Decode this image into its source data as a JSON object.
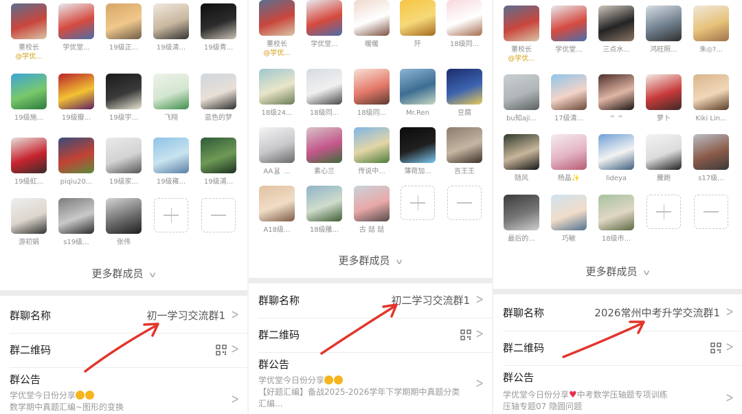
{
  "panels": [
    {
      "members": [
        {
          "name": "董校长",
          "tag": "@学优...",
          "colors": [
            "#5c6f8f",
            "#c9463d",
            "#d8c6a8"
          ]
        },
        {
          "name": "学优堂...",
          "colors": [
            "#e7e9ee",
            "#d64a3f",
            "#4a6ea9"
          ]
        },
        {
          "name": "19级正...",
          "colors": [
            "#d6a765",
            "#f0c88b",
            "#6f5d4a"
          ]
        },
        {
          "name": "19级清...",
          "colors": [
            "#efe9df",
            "#c9b79f",
            "#333"
          ]
        },
        {
          "name": "19级青...",
          "colors": [
            "#0f0f0f",
            "#2c2c2c",
            "#c9c2b5"
          ]
        },
        {
          "name": "19级施...",
          "colors": [
            "#3da4d8",
            "#79c86b",
            "#2c7a3c"
          ]
        },
        {
          "name": "19级瓣...",
          "colors": [
            "#b8232c",
            "#f2c233",
            "#5d1f63"
          ]
        },
        {
          "name": "19级宇...",
          "colors": [
            "#1b1b1b",
            "#3a3a3a",
            "#e9e4d4"
          ]
        },
        {
          "name": "飞翔",
          "colors": [
            "#eef2ea",
            "#d3e6cf",
            "#3f8f4d"
          ]
        },
        {
          "name": "蓝色的梦",
          "colors": [
            "#cfd6df",
            "#e8dfd6",
            "#2d2d2d"
          ]
        },
        {
          "name": "19级虹...",
          "colors": [
            "#e6e0dc",
            "#c7242f",
            "#3a2d2a"
          ]
        },
        {
          "name": "piqiu20...",
          "colors": [
            "#384c7a",
            "#c24334",
            "#5c8c3d"
          ]
        },
        {
          "name": "19级家...",
          "colors": [
            "#e9e9e9",
            "#d3d3d3",
            "#555"
          ]
        },
        {
          "name": "19级雍...",
          "colors": [
            "#8fc2e6",
            "#c8e3f0",
            "#5a7fa3"
          ]
        },
        {
          "name": "19级浦...",
          "colors": [
            "#2f5a38",
            "#6e9a56",
            "#1d3122"
          ]
        },
        {
          "name": "游初娟",
          "colors": [
            "#eeeeee",
            "#dcd6cd",
            "#333"
          ]
        },
        {
          "name": "s19级...",
          "colors": [
            "#7c7c7c",
            "#c9c9c9",
            "#2a2a2a"
          ]
        },
        {
          "name": "张伟",
          "colors": [
            "#d4d4d4",
            "#6e6e6e",
            "#1e1e1e"
          ]
        }
      ],
      "more_label": "更多群成员",
      "group_name_label": "群聊名称",
      "group_name_value": "初一学习交流群1",
      "qr_label": "群二维码",
      "notice_label": "群公告",
      "notice_lines": [
        "学优堂今日份分享",
        "数学期中真题汇编~图形的变换"
      ]
    },
    {
      "members": [
        {
          "name": "董校长",
          "tag": "@学优...",
          "colors": [
            "#5c6f8f",
            "#c9463d",
            "#d8c6a8"
          ]
        },
        {
          "name": "学优堂...",
          "colors": [
            "#e7e9ee",
            "#d64a3f",
            "#4a6ea9"
          ]
        },
        {
          "name": "暖暖",
          "colors": [
            "#eed9cc",
            "#ffffff",
            "#7d5240"
          ]
        },
        {
          "name": "阡",
          "colors": [
            "#f5c542",
            "#f7d97a",
            "#a46a1d"
          ]
        },
        {
          "name": "18级同...",
          "colors": [
            "#f7d8dc",
            "#ffffff",
            "#a66b4e"
          ]
        },
        {
          "name": "18级24...",
          "colors": [
            "#9fc7cf",
            "#e9e5c9",
            "#6a7d54"
          ]
        },
        {
          "name": "18级同...",
          "colors": [
            "#d6dbe2",
            "#f0f0f0",
            "#484848"
          ]
        },
        {
          "name": "18级同...",
          "colors": [
            "#f6e1d7",
            "#e57a6b",
            "#5b3a2f"
          ]
        },
        {
          "name": "Mr.Ren",
          "colors": [
            "#8eb4d4",
            "#3c6e93",
            "#c7d7c2"
          ]
        },
        {
          "name": "豆腐",
          "colors": [
            "#1b2d6b",
            "#3c63b0",
            "#e6c95a"
          ]
        },
        {
          "name": "AA🐰 ...",
          "colors": [
            "#f4f4f4",
            "#c8c8cc",
            "#6a6a6a"
          ]
        },
        {
          "name": "素心兰",
          "colors": [
            "#d7c4c8",
            "#c4578b",
            "#3d6b3a"
          ]
        },
        {
          "name": "传说中...",
          "colors": [
            "#7fb5e4",
            "#e3d6a7",
            "#4c7c3a"
          ]
        },
        {
          "name": "薄荷加...",
          "colors": [
            "#0b0b0b",
            "#202020",
            "#7bc7f0"
          ]
        },
        {
          "name": "吉王王",
          "colors": [
            "#8a7b6d",
            "#c5b5a2",
            "#3b3129"
          ]
        },
        {
          "name": "A18级...",
          "colors": [
            "#e0c2a0",
            "#f0dcc6",
            "#7e5b45"
          ]
        },
        {
          "name": "18级雕...",
          "colors": [
            "#8fb2c8",
            "#cfdccb",
            "#3f5d34"
          ]
        },
        {
          "name": "古 喆 喆",
          "colors": [
            "#c8d3da",
            "#e9a8a8",
            "#534a4a"
          ]
        }
      ],
      "more_label": "更多群成员",
      "group_name_label": "群聊名称",
      "group_name_value": "初二学习交流群1",
      "qr_label": "群二维码",
      "notice_label": "群公告",
      "notice_lines": [
        "学优堂今日份分享",
        "【好题汇编】备战2025-2026学年下学期期中真题分类",
        "汇编..."
      ]
    },
    {
      "members": [
        {
          "name": "董校长",
          "tag": "@学优...",
          "colors": [
            "#5c6f8f",
            "#c9463d",
            "#d8c6a8"
          ]
        },
        {
          "name": "学优堂...",
          "colors": [
            "#e7e9ee",
            "#d64a3f",
            "#4a6ea9"
          ]
        },
        {
          "name": "三点水...",
          "colors": [
            "#cfc7bd",
            "#242424",
            "#8a7565"
          ]
        },
        {
          "name": "鸿旺照...",
          "colors": [
            "#d7dde3",
            "#6f7f8d",
            "#2e2e2e"
          ]
        },
        {
          "name": "朱◎?...",
          "colors": [
            "#efe8da",
            "#e7c27a",
            "#a0724a"
          ]
        },
        {
          "name": "bu知aji...",
          "colors": [
            "#c9cfd2",
            "#b0b6b8",
            "#5b5f60"
          ]
        },
        {
          "name": "17级清...",
          "colors": [
            "#8fc4e9",
            "#f3d4c8",
            "#6a4634"
          ]
        },
        {
          "name": "^ ^",
          "colors": [
            "#4b2f2c",
            "#e0b5a4",
            "#1c1414"
          ]
        },
        {
          "name": "萝卜",
          "colors": [
            "#f3ebe4",
            "#c83a3a",
            "#3c2a26"
          ]
        },
        {
          "name": "Kiki Lin...",
          "colors": [
            "#d9b58b",
            "#f1d7b8",
            "#5a3a24"
          ]
        },
        {
          "name": "随风",
          "colors": [
            "#2f3b2c",
            "#c7b59b",
            "#151515"
          ]
        },
        {
          "name": "杨晶✨",
          "colors": [
            "#f6ecef",
            "#e3b3c4",
            "#b75c74"
          ]
        },
        {
          "name": "lideya",
          "colors": [
            "#6f9fd6",
            "#f2f2f2",
            "#3e5f7e"
          ]
        },
        {
          "name": "騰飽",
          "colors": [
            "#f3f3f3",
            "#dcdcdc",
            "#1f1f1f"
          ]
        },
        {
          "name": "s17级...",
          "colors": [
            "#b9c0c7",
            "#8c5b4a",
            "#3a3a3a"
          ]
        },
        {
          "name": "最后的...",
          "colors": [
            "#3b3b3b",
            "#777",
            "#cfcfcf"
          ]
        },
        {
          "name": "巧敏",
          "colors": [
            "#cfe3f1",
            "#f1dcc8",
            "#51728f"
          ]
        },
        {
          "name": "18级市...",
          "colors": [
            "#a7c1a0",
            "#e0d7c4",
            "#5b6a45"
          ]
        }
      ],
      "more_label": "更多群成员",
      "group_name_label": "群聊名称",
      "group_name_value": "2026常州中考升学交流群1",
      "qr_label": "群二维码",
      "notice_label": "群公告",
      "notice_lines": [
        "学优堂今日份分享",
        "中考数学压轴题专项训练",
        "压轴专题07 隐圆问题"
      ]
    }
  ]
}
